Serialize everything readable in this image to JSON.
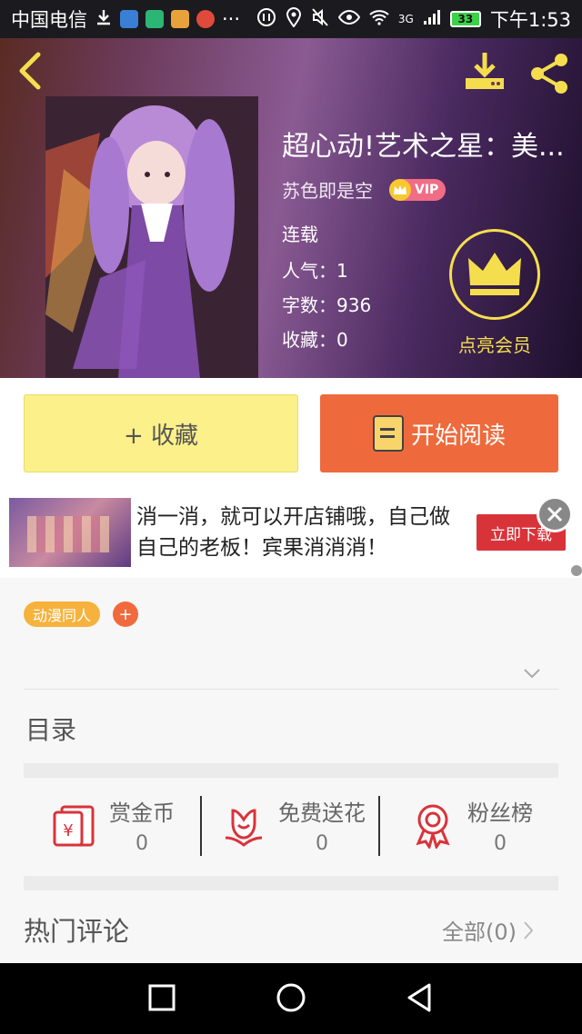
{
  "status_bar": {
    "carrier": "中国电信",
    "more": "···",
    "network": "3G",
    "battery": "33",
    "time": "下午1:53"
  },
  "book": {
    "title": "超心动!艺术之星：美...",
    "author": "苏色即是空",
    "vip_label": "VIP",
    "status": "连载",
    "popularity": "人气：1",
    "word_count": "字数：936",
    "favorites": "收藏：0",
    "member_label": "点亮会员"
  },
  "actions": {
    "collect_label": "+ 收藏",
    "read_label": "开始阅读"
  },
  "ad": {
    "text": "消一消，就可以开店铺哦，自己做自己的老板！宾果消消消！",
    "button_label": "立即下载"
  },
  "tags": [
    "动漫同人"
  ],
  "tag_add_label": "+",
  "toc_label": "目录",
  "stats": [
    {
      "label": "赏金币",
      "value": "0",
      "icon": "red-envelope-icon"
    },
    {
      "label": "免费送花",
      "value": "0",
      "icon": "flower-icon"
    },
    {
      "label": "粉丝榜",
      "value": "0",
      "icon": "medal-icon"
    }
  ],
  "comments": {
    "title": "热门评论",
    "all_label": "全部(0)"
  },
  "colors": {
    "accent_orange": "#ee6a3c",
    "collect_yellow": "#fbf08a",
    "gold": "#f5de4e",
    "tag_orange": "#f6b23d",
    "icon_red": "#d9333a"
  }
}
